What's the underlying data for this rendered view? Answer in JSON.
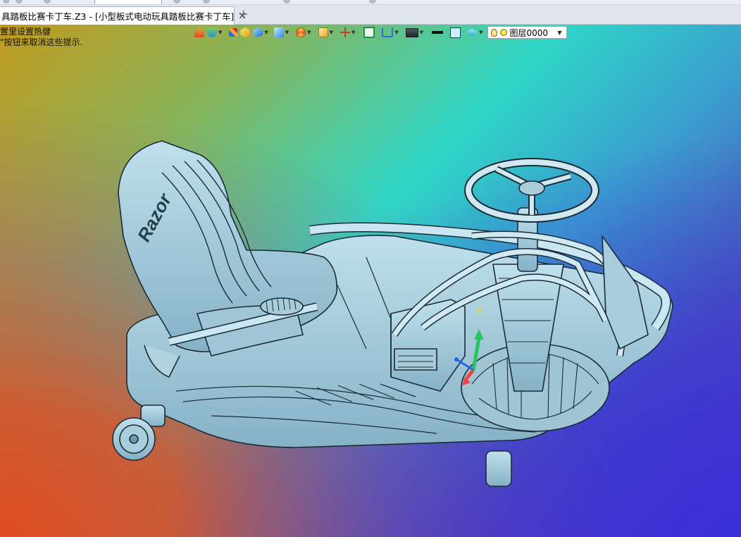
{
  "window": {
    "document_tab_title": "具踏板比赛卡丁车.Z3 - [小型板式电动玩具踏板比赛卡丁车]",
    "close_symbol": "✕",
    "new_tab_symbol": "+"
  },
  "hint": {
    "line1": "置里设置热健",
    "line2": "\"按钮来取消这些提示."
  },
  "toolbar": {
    "buttons": [
      {
        "name": "home-view-icon",
        "dropdown": false
      },
      {
        "name": "flask-display-icon",
        "dropdown": true
      },
      {
        "name": "pen-sketch-icon",
        "dropdown": false
      },
      {
        "name": "shaded-cube-icon",
        "dropdown": false
      },
      {
        "name": "cube-view-icon",
        "dropdown": true
      },
      {
        "name": "view-cube-icon",
        "dropdown": true
      },
      {
        "name": "wheel-icon",
        "dropdown": true
      },
      {
        "name": "zoom-view-icon",
        "dropdown": true
      },
      {
        "name": "axis-icon",
        "dropdown": true
      },
      {
        "name": "frame-icon",
        "dropdown": false
      },
      {
        "name": "split-view-icon",
        "dropdown": true
      },
      {
        "name": "screen-icon",
        "dropdown": true
      },
      {
        "name": "line-style-icon",
        "dropdown": false
      },
      {
        "name": "fill-color-icon",
        "dropdown": false
      },
      {
        "name": "layers-icon",
        "dropdown": true
      }
    ],
    "layer_name": "图层0000"
  },
  "model": {
    "seat_logo": "Razor",
    "axis_label": "Y"
  },
  "colors": {
    "model_fill": "#9cc4d8",
    "model_edge": "#1a2b35",
    "axis_y": "#22c55e",
    "axis_x": "#ef4444",
    "axis_z": "#2563eb"
  }
}
